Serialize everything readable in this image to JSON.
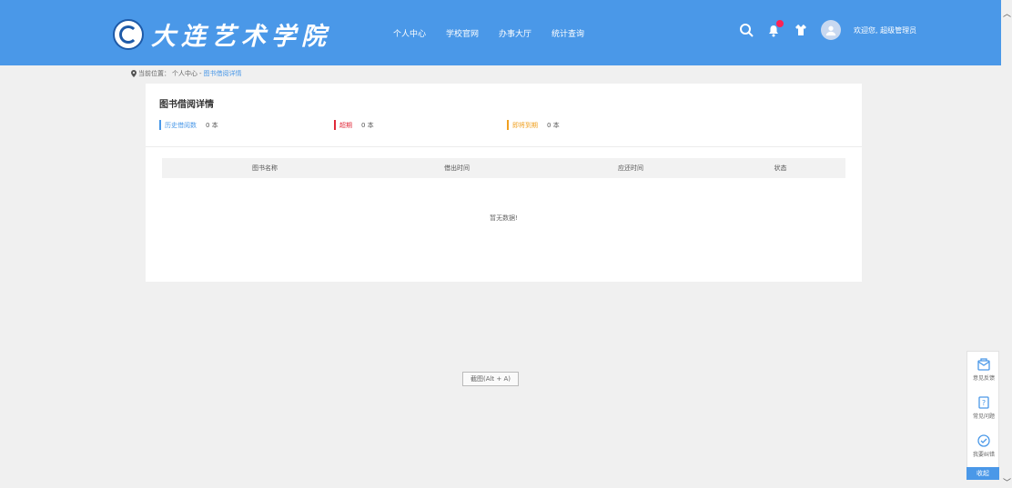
{
  "header": {
    "logo_text": "大连艺术学院",
    "nav": [
      "个人中心",
      "学校官网",
      "办事大厅",
      "统计查询"
    ],
    "welcome": "欢迎您, 超级管理员"
  },
  "breadcrumb": {
    "prefix": "当前位置：",
    "parent": "个人中心",
    "separator": "-",
    "current": "图书借阅详情"
  },
  "card": {
    "title": "图书借阅详情",
    "stats": [
      {
        "label": "历史借阅数",
        "value": "0 本",
        "color": "#4a98e8"
      },
      {
        "label": "超期",
        "value": "0 本",
        "color": "#e02a3a"
      },
      {
        "label": "即将到期",
        "value": "0 本",
        "color": "#f0a020"
      }
    ]
  },
  "table": {
    "columns": [
      "图书名称",
      "借出时间",
      "应还时间",
      "状态"
    ],
    "empty_text": "暂无数据!"
  },
  "shortcut_hint": "截图(Alt + A)",
  "side_panel": {
    "items": [
      "意见反馈",
      "常见问题",
      "我要纠错"
    ],
    "collapse": "收起"
  },
  "colors": {
    "header_bg": "#4a98e8",
    "accent": "#4a98e8"
  }
}
